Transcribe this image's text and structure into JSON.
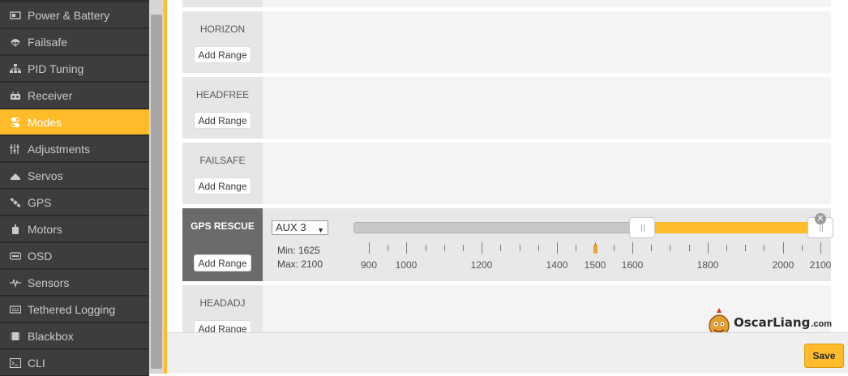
{
  "sidebar": {
    "items": [
      {
        "label": "Power & Battery",
        "icon": "battery-icon"
      },
      {
        "label": "Failsafe",
        "icon": "parachute-icon"
      },
      {
        "label": "PID Tuning",
        "icon": "pid-tree-icon"
      },
      {
        "label": "Receiver",
        "icon": "receiver-icon"
      },
      {
        "label": "Modes",
        "icon": "toggle-icon",
        "active": true
      },
      {
        "label": "Adjustments",
        "icon": "sliders-icon"
      },
      {
        "label": "Servos",
        "icon": "servo-icon"
      },
      {
        "label": "GPS",
        "icon": "satellite-icon"
      },
      {
        "label": "Motors",
        "icon": "motor-icon"
      },
      {
        "label": "OSD",
        "icon": "osd-icon"
      },
      {
        "label": "Sensors",
        "icon": "pulse-icon"
      },
      {
        "label": "Tethered Logging",
        "icon": "keyboard-icon"
      },
      {
        "label": "Blackbox",
        "icon": "blackbox-icon"
      },
      {
        "label": "CLI",
        "icon": "terminal-icon"
      }
    ]
  },
  "modes": [
    {
      "name": "HORIZON",
      "add_range_label": "Add Range"
    },
    {
      "name": "HEADFREE",
      "add_range_label": "Add Range"
    },
    {
      "name": "FAILSAFE",
      "add_range_label": "Add Range"
    },
    {
      "name": "GPS RESCUE",
      "add_range_label": "Add Range",
      "aux_channel": "AUX 3",
      "min_text": "Min: 1625",
      "max_text": "Max: 2100",
      "range_min": 1625,
      "range_max": 2100,
      "current_value": 1500
    },
    {
      "name": "HEADADJ",
      "add_range_label": "Add Range"
    }
  ],
  "scale": {
    "min": 900,
    "max": 2100,
    "labels": [
      "900",
      "1000",
      "1200",
      "1400",
      "1500",
      "1600",
      "1800",
      "2000",
      "2100"
    ],
    "label_values": [
      900,
      1000,
      1200,
      1400,
      1500,
      1600,
      1800,
      2000,
      2100
    ]
  },
  "footer": {
    "save_label": "Save"
  },
  "watermark": {
    "brand": "OscarLiang",
    "suffix": ".com"
  },
  "colors": {
    "accent": "#ffbb2a",
    "sidebar_bg": "#3d3d3d",
    "active_name_bg": "#6a6a6a"
  }
}
